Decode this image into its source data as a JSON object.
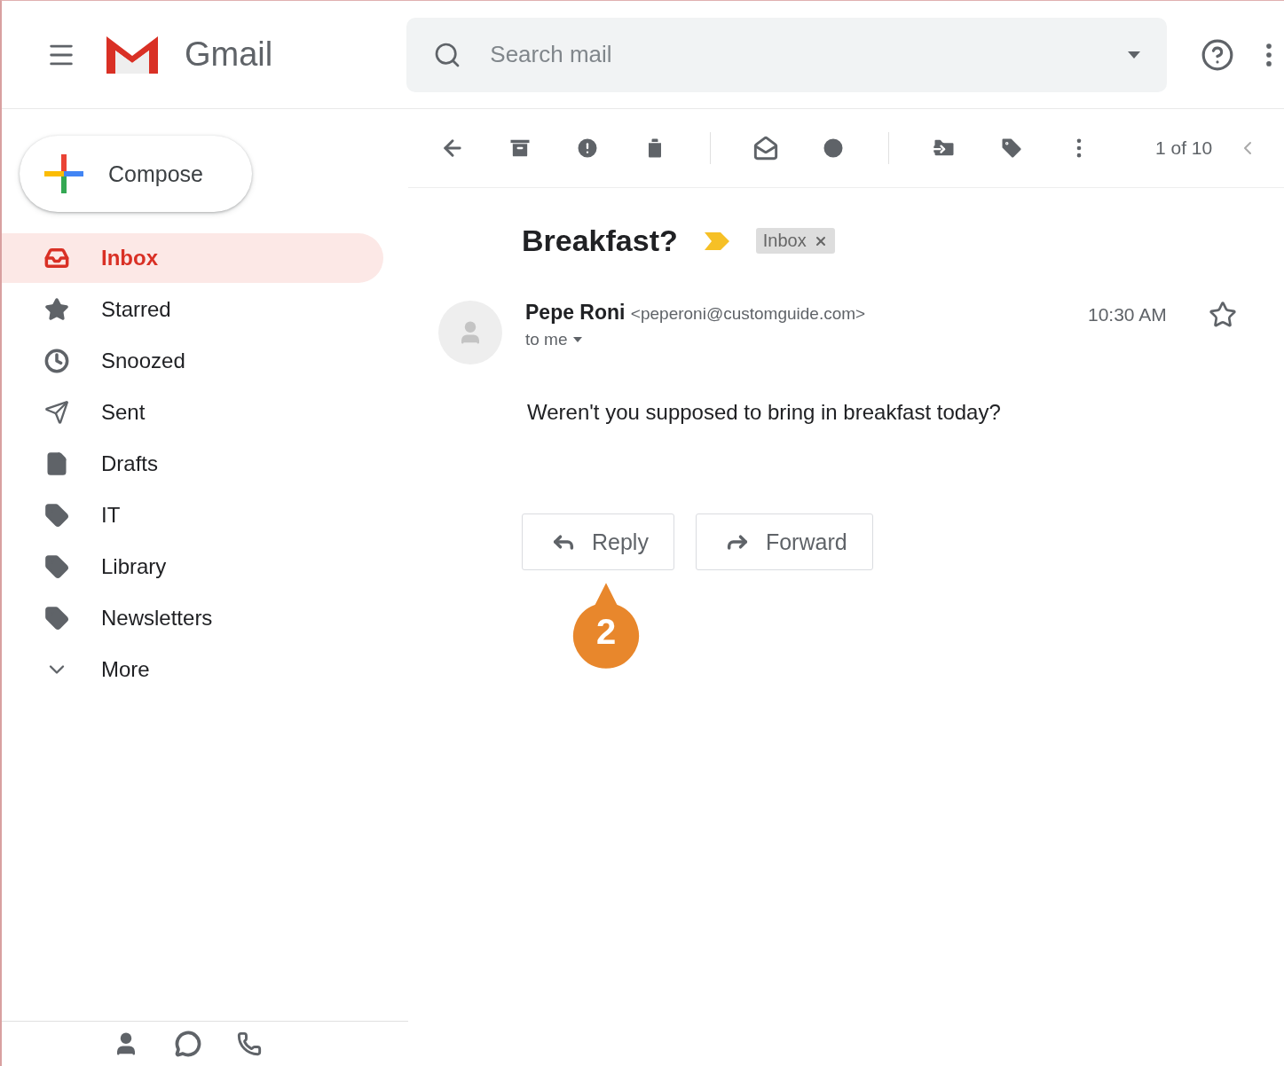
{
  "header": {
    "app_name": "Gmail",
    "search": {
      "placeholder": "Search mail"
    }
  },
  "compose": {
    "label": "Compose"
  },
  "nav": [
    {
      "kind": "inbox",
      "label": "Inbox",
      "selected": true
    },
    {
      "kind": "starred",
      "label": "Starred",
      "selected": false
    },
    {
      "kind": "snoozed",
      "label": "Snoozed",
      "selected": false
    },
    {
      "kind": "sent",
      "label": "Sent",
      "selected": false
    },
    {
      "kind": "drafts",
      "label": "Drafts",
      "selected": false
    },
    {
      "kind": "label",
      "label": "IT",
      "selected": false
    },
    {
      "kind": "label",
      "label": "Library",
      "selected": false
    },
    {
      "kind": "label",
      "label": "Newsletters",
      "selected": false
    },
    {
      "kind": "more",
      "label": "More",
      "selected": false
    }
  ],
  "toolbar": {
    "pager": "1 of 10"
  },
  "message": {
    "subject": "Breakfast?",
    "important": true,
    "label_chip": "Inbox",
    "sender_name": "Pepe Roni",
    "sender_email": "<peperoni@customguide.com>",
    "recipient": "to me",
    "time": "10:30 AM",
    "starred": false,
    "body": "Weren't you supposed to bring in breakfast today?"
  },
  "actions": [
    {
      "kind": "reply",
      "label": "Reply"
    },
    {
      "kind": "forward",
      "label": "Forward"
    }
  ],
  "callout": {
    "label": "2"
  }
}
